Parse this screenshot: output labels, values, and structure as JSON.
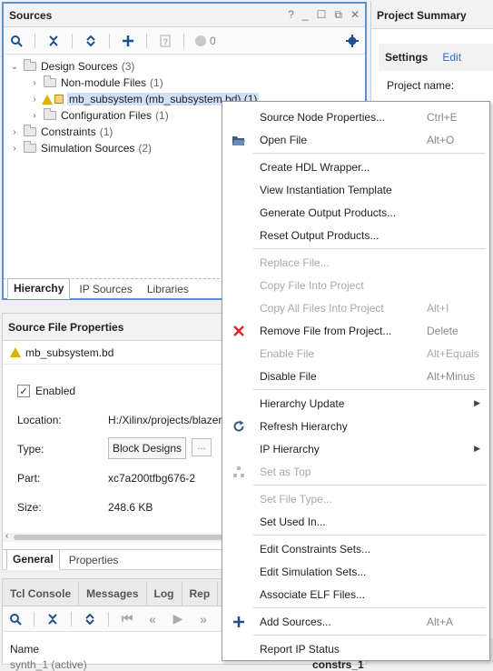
{
  "sources": {
    "title": "Sources",
    "controls": [
      "?",
      "_",
      "☐",
      "⧉",
      "✕"
    ],
    "status_count": "0",
    "tree": [
      {
        "label": "Design Sources",
        "count": "(3)"
      },
      {
        "label": "Non-module Files",
        "count": "(1)"
      },
      {
        "label": "mb_subsystem (mb_subsystem.bd) (1)",
        "count": ""
      },
      {
        "label": "Configuration Files",
        "count": "(1)"
      },
      {
        "label": "Constraints",
        "count": "(1)"
      },
      {
        "label": "Simulation Sources",
        "count": "(2)"
      }
    ],
    "tabs": [
      "Hierarchy",
      "IP Sources",
      "Libraries"
    ]
  },
  "project_summary": {
    "title": "Project Summary",
    "settings_label": "Settings",
    "edit_label": "Edit",
    "project_name_label": "Project name:"
  },
  "source_file_properties": {
    "title": "Source File Properties",
    "file_name": "mb_subsystem.bd",
    "enabled_label": "Enabled",
    "location_label": "Location:",
    "location_value": "H:/Xilinx/projects/blazer",
    "type_label": "Type:",
    "type_value": "Block Designs",
    "type_button": "...",
    "part_label": "Part:",
    "part_value": "xc7a200tfbg676-2",
    "size_label": "Size:",
    "size_value": "248.6 KB",
    "tabs": [
      "General",
      "Properties"
    ]
  },
  "console": {
    "tabs": [
      "Tcl Console",
      "Messages",
      "Log",
      "Rep"
    ],
    "name_header": "Name",
    "run_row": "synth_1 (active)",
    "right_cell": "constrs_1"
  },
  "context_menu": {
    "items": [
      {
        "label": "Source Node Properties...",
        "shortcut": "Ctrl+E"
      },
      {
        "label": "Open File",
        "shortcut": "Alt+O"
      },
      {
        "label": "Create HDL Wrapper...",
        "shortcut": ""
      },
      {
        "label": "View Instantiation Template",
        "shortcut": ""
      },
      {
        "label": "Generate Output Products...",
        "shortcut": ""
      },
      {
        "label": "Reset Output Products...",
        "shortcut": ""
      },
      {
        "label": "Replace File...",
        "shortcut": ""
      },
      {
        "label": "Copy File Into Project",
        "shortcut": ""
      },
      {
        "label": "Copy All Files Into Project",
        "shortcut": "Alt+I"
      },
      {
        "label": "Remove File from Project...",
        "shortcut": "Delete"
      },
      {
        "label": "Enable File",
        "shortcut": "Alt+Equals"
      },
      {
        "label": "Disable File",
        "shortcut": "Alt+Minus"
      },
      {
        "label": "Hierarchy Update",
        "shortcut": ""
      },
      {
        "label": "Refresh Hierarchy",
        "shortcut": ""
      },
      {
        "label": "IP Hierarchy",
        "shortcut": ""
      },
      {
        "label": "Set as Top",
        "shortcut": ""
      },
      {
        "label": "Set File Type...",
        "shortcut": ""
      },
      {
        "label": "Set Used In...",
        "shortcut": ""
      },
      {
        "label": "Edit Constraints Sets...",
        "shortcut": ""
      },
      {
        "label": "Edit Simulation Sets...",
        "shortcut": ""
      },
      {
        "label": "Associate ELF Files...",
        "shortcut": ""
      },
      {
        "label": "Add Sources...",
        "shortcut": "Alt+A"
      },
      {
        "label": "Report IP Status",
        "shortcut": ""
      }
    ]
  },
  "colors": {
    "accent": "#5b8fd6",
    "selection": "#cfe0f7",
    "remove_icon": "#e0242b",
    "link": "#2a6cc0"
  }
}
